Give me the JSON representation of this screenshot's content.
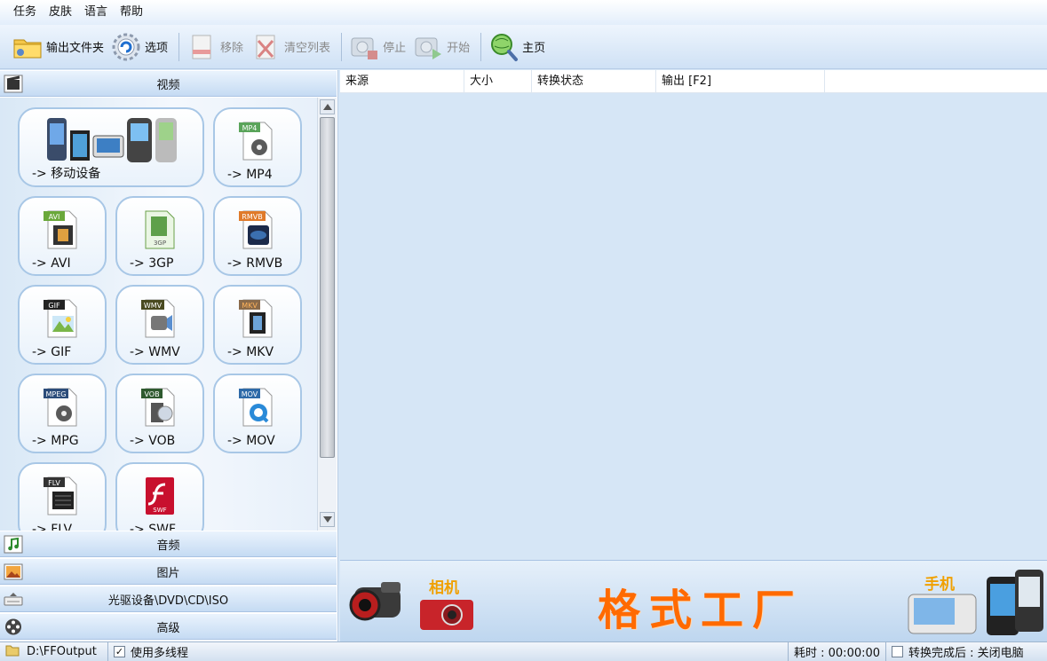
{
  "menu": [
    "任务",
    "皮肤",
    "语言",
    "帮助"
  ],
  "toolbar": {
    "output_folder": "输出文件夹",
    "options": "选项",
    "remove": "移除",
    "clear_list": "清空列表",
    "stop": "停止",
    "start": "开始",
    "home": "主页"
  },
  "categories": {
    "video": "视频",
    "audio": "音频",
    "picture": "图片",
    "rom": "光驱设备\\DVD\\CD\\ISO",
    "advanced": "高级"
  },
  "tiles": [
    {
      "label": "-> 移动设备",
      "badge": ""
    },
    {
      "label": "-> MP4",
      "badge": "MP4"
    },
    {
      "label": "-> AVI",
      "badge": "AVI"
    },
    {
      "label": "-> 3GP",
      "badge": "3GP"
    },
    {
      "label": "-> RMVB",
      "badge": "RMVB"
    },
    {
      "label": "-> GIF",
      "badge": "GIF"
    },
    {
      "label": "-> WMV",
      "badge": "WMV"
    },
    {
      "label": "-> MKV",
      "badge": "MKV"
    },
    {
      "label": "-> MPG",
      "badge": "MPEG"
    },
    {
      "label": "-> VOB",
      "badge": "VOB"
    },
    {
      "label": "-> MOV",
      "badge": "MOV"
    },
    {
      "label": "-> FLV",
      "badge": "FLV"
    },
    {
      "label": "-> SWF",
      "badge": "SWF"
    }
  ],
  "columns": [
    "来源",
    "大小",
    "转换状态",
    "输出 [F2]"
  ],
  "banner": {
    "title": "格式工厂",
    "camera": "相机",
    "phone": "手机"
  },
  "status": {
    "output_path": "D:\\FFOutput",
    "multithread": "使用多线程",
    "elapsed": "耗时 : 00:00:00",
    "after_convert": "转换完成后 : 关闭电脑"
  },
  "colors": {
    "accent_orange": "#ff6a00",
    "panel_blue": "#d6e6f6",
    "tile_border": "#a8c7e6"
  }
}
